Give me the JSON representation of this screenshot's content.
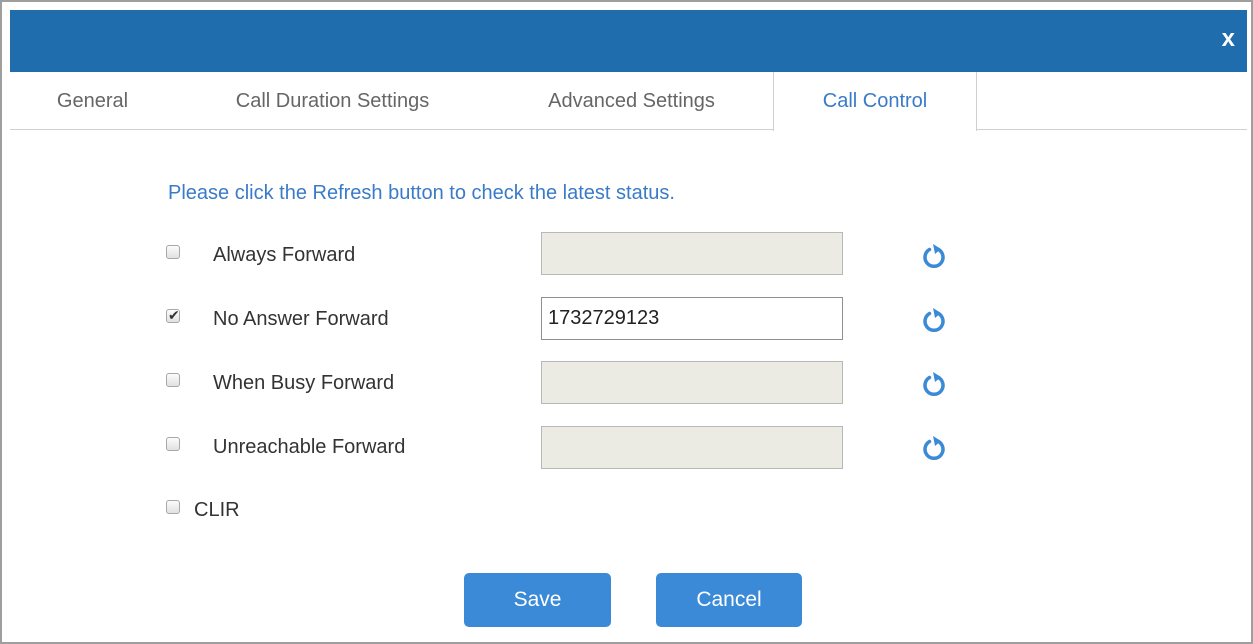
{
  "dialog": {
    "close_label": "x"
  },
  "tabs": [
    {
      "label": "General",
      "active": false
    },
    {
      "label": "Call Duration Settings",
      "active": false
    },
    {
      "label": "Advanced Settings",
      "active": false
    },
    {
      "label": "Call Control",
      "active": true
    }
  ],
  "call_control": {
    "hint": "Please click the Refresh button to check the latest status.",
    "rows": [
      {
        "label": "Always Forward",
        "checked": false,
        "value": "",
        "enabled": false
      },
      {
        "label": "No Answer Forward",
        "checked": true,
        "value": "1732729123",
        "enabled": true
      },
      {
        "label": "When Busy Forward",
        "checked": false,
        "value": "",
        "enabled": false
      },
      {
        "label": "Unreachable Forward",
        "checked": false,
        "value": "",
        "enabled": false
      }
    ],
    "clir": {
      "label": "CLIR",
      "checked": false
    }
  },
  "buttons": {
    "save_label": "Save",
    "cancel_label": "Cancel"
  },
  "colors": {
    "titlebar": "#1f6dad",
    "accent": "#3a7bc8",
    "button": "#3a8ad8"
  },
  "icons": {
    "close": "close-icon",
    "refresh": "refresh-icon",
    "check": "checkmark-icon"
  }
}
